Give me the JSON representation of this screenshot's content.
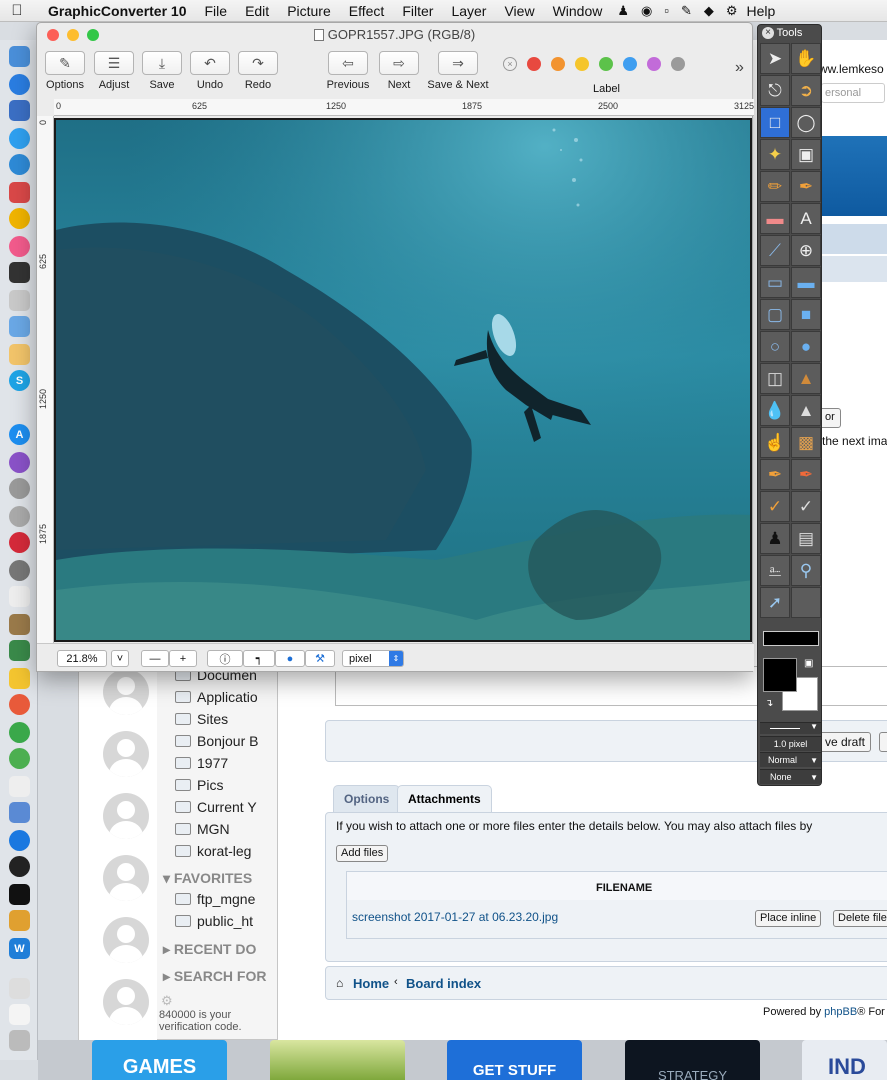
{
  "menubar": {
    "app": "GraphicConverter 10",
    "items": [
      "File",
      "Edit",
      "Picture",
      "Effect",
      "Filter",
      "Layer",
      "View",
      "Window"
    ],
    "help": "Help"
  },
  "window": {
    "title": "GOPR1557.JPG (RGB/8)",
    "toolbar": {
      "options": "Options",
      "adjust": "Adjust",
      "save": "Save",
      "undo": "Undo",
      "redo": "Redo",
      "previous": "Previous",
      "next": "Next",
      "save_next": "Save & Next",
      "label": "Label",
      "more": "»"
    },
    "label_colors": [
      "#e8493f",
      "#f2932f",
      "#f5c52c",
      "#5cc24a",
      "#3f9ef0",
      "#c26bd9",
      "#9a9a9a"
    ],
    "ruler_h": [
      "0",
      "625",
      "1250",
      "1875",
      "2500",
      "3125"
    ],
    "ruler_v": [
      "0",
      "625",
      "1250",
      "1875"
    ],
    "zoom": "21.8%",
    "units": "pixel"
  },
  "tools": {
    "title": "Tools",
    "line_width": "1.0 pixel",
    "blend": "Normal",
    "fill": "None",
    "fg_color": "#000000",
    "bg_color": "#ffffff"
  },
  "finder": {
    "items": [
      "Documen",
      "Applicatio",
      "Sites",
      "Bonjour B",
      "1977",
      "Pics",
      "Current Y",
      "MGN",
      "korat-leg"
    ],
    "favorites_hdr": "FAVORITES",
    "favorites": [
      "ftp_mgne",
      "public_ht"
    ],
    "recent": "RECENT DO",
    "search": "SEARCH FOR",
    "footer1": "840000 is your",
    "footer2": "verification code."
  },
  "forum": {
    "url": "ww.lemkeso",
    "personal": "ersonal",
    "or_btn": "or",
    "next_img": "the next ima",
    "save_draft": "ve draft",
    "tab_options": "Options",
    "tab_attach": "Attachments",
    "attach_text": "If you wish to attach one or more files enter the details below. You may also attach files by",
    "add_files": "Add files",
    "filename_hdr": "FILENAME",
    "file": "screenshot 2017-01-27 at 06.23.20.jpg",
    "place_inline": "Place inline",
    "delete_file": "Delete file",
    "home": "Home",
    "board_index": "Board index",
    "powered": "Powered by",
    "phpbb": "phpBB",
    "forum_sw": "® For"
  },
  "thumbs": {
    "games": "GAMES",
    "get_stuff": "GET STUFF",
    "strategy": "STRATEGY",
    "ind": "IND"
  }
}
